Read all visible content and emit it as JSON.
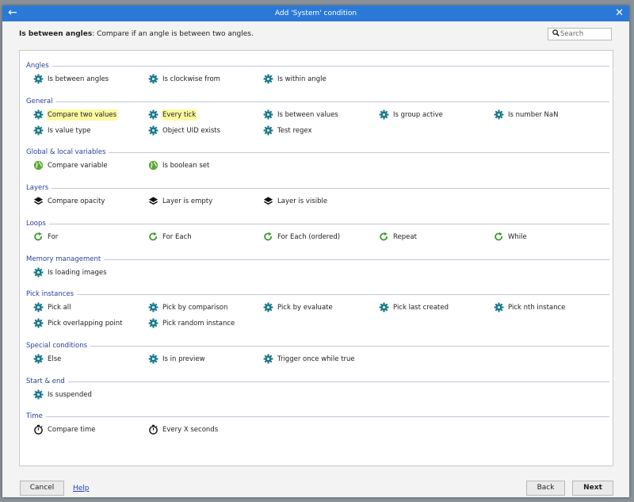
{
  "window": {
    "title": "Add 'System' condition",
    "back_glyph": "←",
    "close_glyph": "✕"
  },
  "description": {
    "name": "Is between angles",
    "text": ": Compare if an angle is between two angles."
  },
  "search": {
    "placeholder": "Search",
    "icon_glyph": "🔍"
  },
  "groups": [
    {
      "name": "Angles",
      "items": [
        {
          "label": "Is between angles",
          "icon": "gear-icon",
          "highlight": false
        },
        {
          "label": "Is clockwise from",
          "icon": "gear-icon",
          "highlight": false
        },
        {
          "label": "Is within angle",
          "icon": "gear-icon",
          "highlight": false
        }
      ]
    },
    {
      "name": "General",
      "items": [
        {
          "label": "Compare two values",
          "icon": "gear-icon",
          "highlight": true
        },
        {
          "label": "Every tick",
          "icon": "gear-icon",
          "highlight": true
        },
        {
          "label": "Is between values",
          "icon": "gear-icon",
          "highlight": false
        },
        {
          "label": "Is group active",
          "icon": "gear-icon",
          "highlight": false
        },
        {
          "label": "Is number NaN",
          "icon": "gear-icon",
          "highlight": false
        },
        {
          "label": "Is value type",
          "icon": "gear-icon",
          "highlight": false
        },
        {
          "label": "Object UID exists",
          "icon": "gear-icon",
          "highlight": false
        },
        {
          "label": "Test regex",
          "icon": "gear-icon",
          "highlight": false
        }
      ]
    },
    {
      "name": "Global & local variables",
      "items": [
        {
          "label": "Compare variable",
          "icon": "globe-icon",
          "highlight": false
        },
        {
          "label": "Is boolean set",
          "icon": "globe-icon",
          "highlight": false
        }
      ]
    },
    {
      "name": "Layers",
      "items": [
        {
          "label": "Compare opacity",
          "icon": "layers-icon",
          "highlight": false
        },
        {
          "label": "Layer is empty",
          "icon": "layers-icon",
          "highlight": false
        },
        {
          "label": "Layer is visible",
          "icon": "layers-icon",
          "highlight": false
        }
      ]
    },
    {
      "name": "Loops",
      "items": [
        {
          "label": "For",
          "icon": "loop-icon",
          "highlight": false
        },
        {
          "label": "For Each",
          "icon": "loop-icon",
          "highlight": false
        },
        {
          "label": "For Each (ordered)",
          "icon": "loop-icon",
          "highlight": false
        },
        {
          "label": "Repeat",
          "icon": "loop-icon",
          "highlight": false
        },
        {
          "label": "While",
          "icon": "loop-icon",
          "highlight": false
        }
      ]
    },
    {
      "name": "Memory management",
      "items": [
        {
          "label": "Is loading images",
          "icon": "gear-icon",
          "highlight": false
        }
      ]
    },
    {
      "name": "Pick instances",
      "items": [
        {
          "label": "Pick all",
          "icon": "gear-icon",
          "highlight": false
        },
        {
          "label": "Pick by comparison",
          "icon": "gear-icon",
          "highlight": false
        },
        {
          "label": "Pick by evaluate",
          "icon": "gear-icon",
          "highlight": false
        },
        {
          "label": "Pick last created",
          "icon": "gear-icon",
          "highlight": false
        },
        {
          "label": "Pick nth instance",
          "icon": "gear-icon",
          "highlight": false
        },
        {
          "label": "Pick overlapping point",
          "icon": "gear-icon",
          "highlight": false
        },
        {
          "label": "Pick random instance",
          "icon": "gear-icon",
          "highlight": false
        }
      ]
    },
    {
      "name": "Special conditions",
      "items": [
        {
          "label": "Else",
          "icon": "gear-icon",
          "highlight": false
        },
        {
          "label": "Is in preview",
          "icon": "gear-icon",
          "highlight": false
        },
        {
          "label": "Trigger once while true",
          "icon": "gear-icon",
          "highlight": false
        }
      ]
    },
    {
      "name": "Start & end",
      "items": [
        {
          "label": "Is suspended",
          "icon": "gear-icon",
          "highlight": false
        }
      ]
    },
    {
      "name": "Time",
      "items": [
        {
          "label": "Compare time",
          "icon": "stopwatch-icon",
          "highlight": false
        },
        {
          "label": "Every X seconds",
          "icon": "stopwatch-icon",
          "highlight": false
        }
      ]
    }
  ],
  "buttons": {
    "cancel": "Cancel",
    "help": "Help",
    "back": "Back",
    "next": "Next"
  },
  "colors": {
    "titlebar": "#2b79d7",
    "gear": "#1a7a8c",
    "globe": "#5aa832",
    "loop": "#3b9a2a",
    "highlight": "#fdf9a0",
    "group_heading": "#2a3f99"
  }
}
